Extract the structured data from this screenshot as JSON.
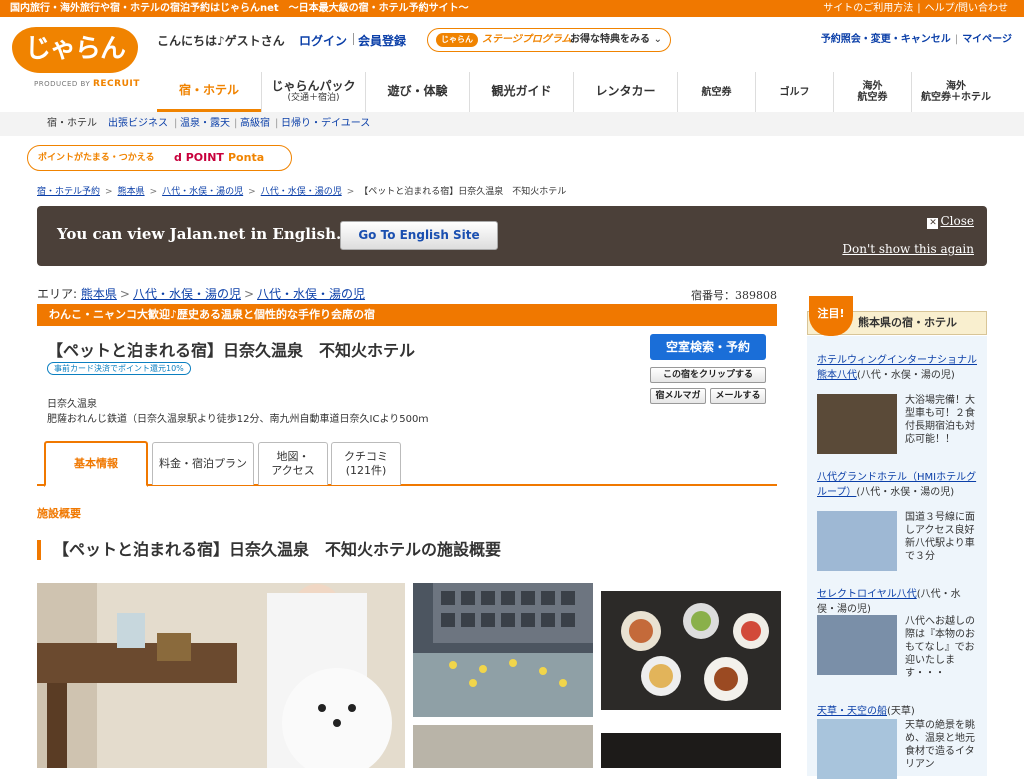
{
  "topbar": {
    "tagline": "国内旅行・海外旅行や宿・ホテルの宿泊予約はじゃらんnet　〜日本最大級の宿・ホテル予約サイト〜",
    "links": [
      "サイトのご利用方法",
      "ヘルプ/問い合わせ"
    ]
  },
  "header": {
    "logo": "じゃらん",
    "logo_sub": "PRODUCED BY",
    "logo_sub_brand": "RECRUIT",
    "greeting": "こんにちは♪ゲストさん",
    "login": "ログイン",
    "register": "会員登録",
    "stage_tag": "じゃらん",
    "stage_program": "ステージプログラム",
    "stage_benefit": "お得な特典をみる",
    "links": [
      "予約照会・変更・キャンセル",
      "マイページ"
    ]
  },
  "gnav": [
    {
      "label": "宿・ホテル"
    },
    {
      "label": "じゃらんパック",
      "sub": "(交通＋宿泊)"
    },
    {
      "label": "遊び・体験"
    },
    {
      "label": "観光ガイド"
    },
    {
      "label": "レンタカー"
    },
    {
      "label": "航空券"
    },
    {
      "label": "ゴルフ"
    },
    {
      "label": "海外",
      "sub2": "航空券"
    },
    {
      "label": "海外",
      "sub2": "航空券＋ホテル"
    }
  ],
  "subnav": [
    "宿・ホテル",
    "出張ビジネス",
    "温泉・露天",
    "高級宿",
    "日帰り・デイユース"
  ],
  "points": {
    "text": "ポイントがたまる・つかえる",
    "dpoint": "d POINT",
    "ponta": "Ponta"
  },
  "breadcrumb": [
    "宿・ホテル予約",
    "熊本県",
    "八代・水俣・湯の児",
    "八代・水俣・湯の児",
    "【ペットと泊まれる宿】日奈久温泉　不知火ホテル"
  ],
  "english": {
    "message": "You can view Jalan.net in English.",
    "button": "Go To English Site",
    "close": "Close",
    "dont_show": "Don't show this again"
  },
  "area": {
    "label": "エリア:",
    "items": [
      "熊本県",
      "八代・水俣・湯の児",
      "八代・水俣・湯の児"
    ],
    "yado_no": "宿番号：389808"
  },
  "hotel": {
    "catch": "わんこ・ニャンコ大歓迎♪歴史ある温泉と個性的な手作り会席の宿",
    "name": "【ペットと泊まれる宿】日奈久温泉　不知火ホテル",
    "card_badge": "事前カード決済でポイント還元10%",
    "onsen": "日奈久温泉",
    "access": "肥薩おれんじ鉄道（日奈久温泉駅より徒歩12分、南九州自動車道日奈久ICより500ｍ",
    "btn_search": "空室検索・予約",
    "btn_clip": "この宿をクリップする",
    "btn_mag": "宿メルマガ",
    "btn_mail": "メールする"
  },
  "tabs": [
    {
      "label": "基本情報"
    },
    {
      "label": "料金・宿泊プラン"
    },
    {
      "label": "地図・",
      "label2": "アクセス"
    },
    {
      "label": "クチコミ",
      "label2": "(121件)"
    }
  ],
  "section": {
    "small": "施設概要",
    "title": "【ペットと泊まれる宿】日奈久温泉　不知火ホテルの施設概要"
  },
  "sidebar": {
    "flag": "注目!",
    "title": "熊本県の宿・ホテル",
    "items": [
      {
        "name": "ホテルウィングインターナショナル熊本八代",
        "area": "(八代・水俣・湯の児)",
        "desc": "大浴場完備！大型車も可！２食付長期宿泊も対応可能！！"
      },
      {
        "name": "八代グランドホテル（HMIホテルグループ）",
        "area": "(八代・水俣・湯の児)",
        "desc": "国道３号線に面しアクセス良好　新八代駅より車で３分"
      },
      {
        "name": "セレクトロイヤル八代",
        "area": "(八代・水俣・湯の児)",
        "desc": "八代へお越しの際は『本物のおもてなし』でお迎いたします・・・"
      },
      {
        "name": "天草・天空の船",
        "area": "(天草)",
        "desc": "天草の絶景を眺め、温泉と地元食材で造るイタリアン"
      }
    ]
  },
  "colors": {
    "accent": "#f07800",
    "link": "#0b3fa8",
    "banner": "#4b4039"
  }
}
